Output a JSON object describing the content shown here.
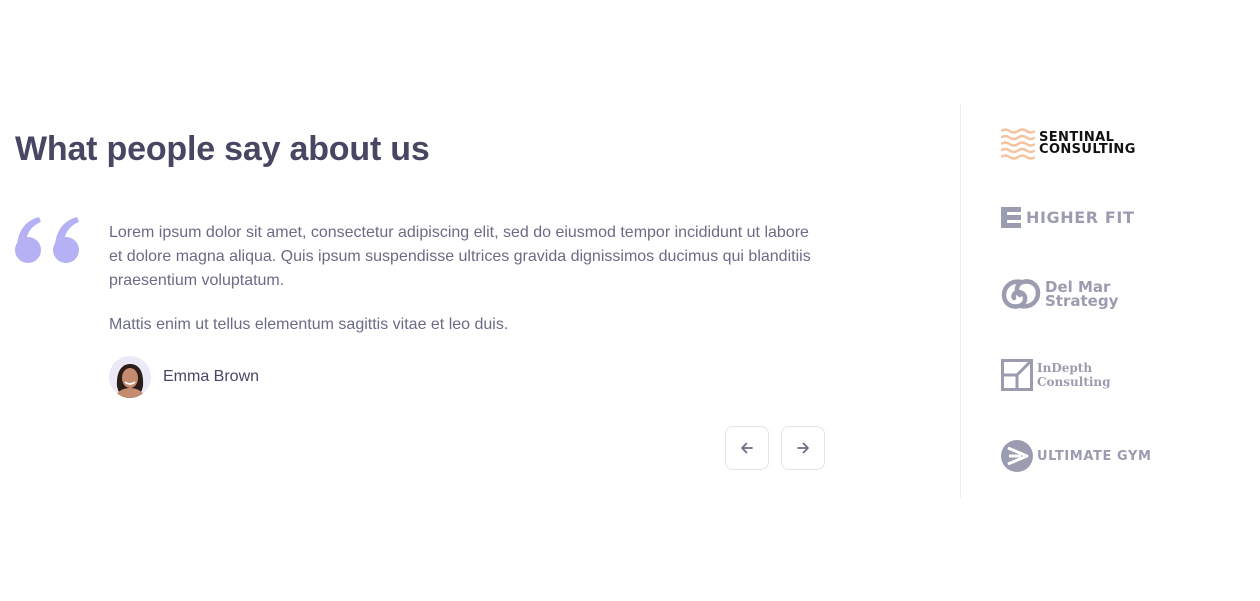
{
  "section": {
    "title": "What people say about us"
  },
  "testimonial": {
    "paragraphs": [
      "Lorem ipsum dolor sit amet, consectetur adipiscing elit, sed do eiusmod tempor incididunt ut labore et dolore magna aliqua. Quis ipsum suspendisse ultrices gravida dignissimos ducimus qui blanditiis praesentium voluptatum.",
      "Mattis enim ut tellus elementum sagittis vitae et leo duis."
    ],
    "author": {
      "name": "Emma Brown",
      "avatar_icon": "person-avatar"
    },
    "quote_icon": "quote-mark-icon",
    "quote_color": "#b6b1f5"
  },
  "navigation": {
    "prev_icon": "arrow-left-icon",
    "next_icon": "arrow-right-icon"
  },
  "logos": [
    {
      "lines": [
        "SENTINAL",
        "CONSULTING"
      ],
      "icon": "wave-lines-icon",
      "accent": "#f3c3a0"
    },
    {
      "lines": [
        "HIGHER FIT"
      ],
      "icon": "stacked-bars-icon"
    },
    {
      "lines": [
        "Del Mar",
        "Strategy"
      ],
      "icon": "swirl-icon"
    },
    {
      "lines": [
        "InDepth",
        "Consulting"
      ],
      "icon": "framed-square-icon"
    },
    {
      "lines": [
        "ULTIMATE GYM"
      ],
      "icon": "play-circle-icon"
    }
  ],
  "colors": {
    "heading": "#474764",
    "body_text": "#6b6b86",
    "logo_gray": "#9c9cb0",
    "divider": "#ececf2"
  }
}
